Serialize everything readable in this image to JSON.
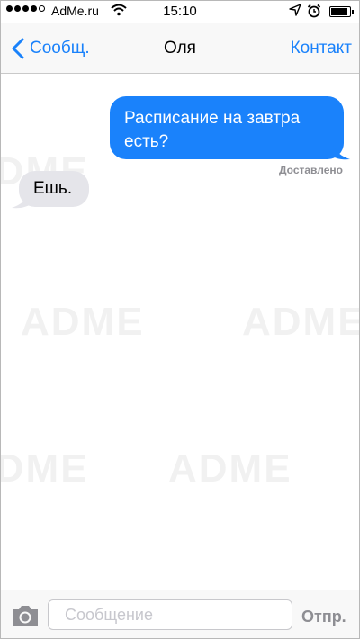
{
  "status_bar": {
    "carrier": "AdMe.ru",
    "time": "15:10",
    "signal_bars_filled": 4,
    "signal_bars_total": 5,
    "battery_level": 0.9
  },
  "nav": {
    "back_label": "Сообщ.",
    "title": "Оля",
    "contact_label": "Контакт"
  },
  "messages": [
    {
      "direction": "outgoing",
      "text": "Расписание на завтра есть?",
      "status": "Доставлено"
    },
    {
      "direction": "incoming",
      "text": "Ешь."
    }
  ],
  "input": {
    "placeholder": "Сообщение",
    "value": "",
    "send_label": "Отпр."
  },
  "watermark": "ADME",
  "colors": {
    "accent": "#1a82fb",
    "incoming_bubble": "#e5e5ea",
    "bar_background": "#f8f8f8",
    "muted_text": "#8e8e93"
  },
  "icons": [
    "signal-icon",
    "wifi-icon",
    "location-icon",
    "alarm-icon",
    "battery-icon",
    "chevron-left-icon",
    "camera-icon"
  ]
}
